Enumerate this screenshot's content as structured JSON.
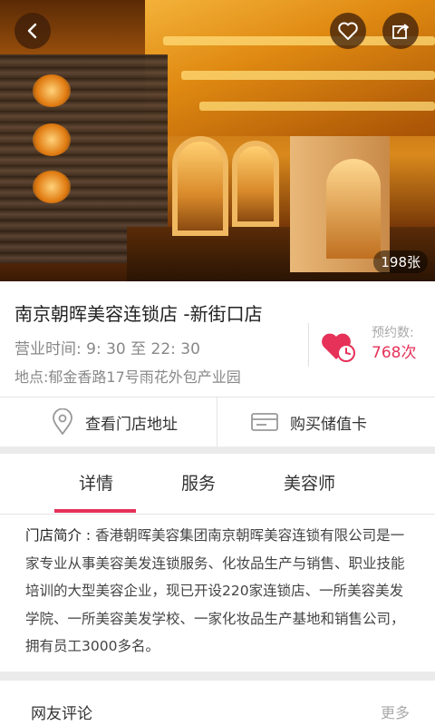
{
  "hero": {
    "photo_count": "198张"
  },
  "store": {
    "name": "南京朝晖美容连锁店 -新街口店",
    "hours": "营业时间:  9:  30 至 22:  30",
    "address": "地点:郁金香路17号雨花外包产业园",
    "booking_label": "预约数:",
    "booking_count": "768次"
  },
  "actions": {
    "view_address": "查看门店地址",
    "buy_card": "购买储值卡"
  },
  "tabs": [
    {
      "label": "详情",
      "active": true
    },
    {
      "label": "服务",
      "active": false
    },
    {
      "label": "美容师",
      "active": false
    }
  ],
  "description": {
    "heading": "门店简介 :",
    "text": " 香港朝晖美容集团南京朝晖美容连锁有限公司是一家专业从事美容美发连锁服务、化妆品生产与销售、职业技能培训的大型美容企业，现已开设220家连锁店、一所美容美发学院、一所美容美发学校、一家化妆品生产基地和销售公司，拥有员工3000多名。"
  },
  "comments": {
    "title": "网友评论",
    "more": "更多"
  },
  "colors": {
    "accent": "#e63159",
    "muted": "#888888",
    "divider_gap": "#ebebeb"
  },
  "icons": [
    "back-arrow-icon",
    "heart-icon",
    "share-icon",
    "heart-clock-icon",
    "location-pin-icon",
    "card-icon"
  ]
}
